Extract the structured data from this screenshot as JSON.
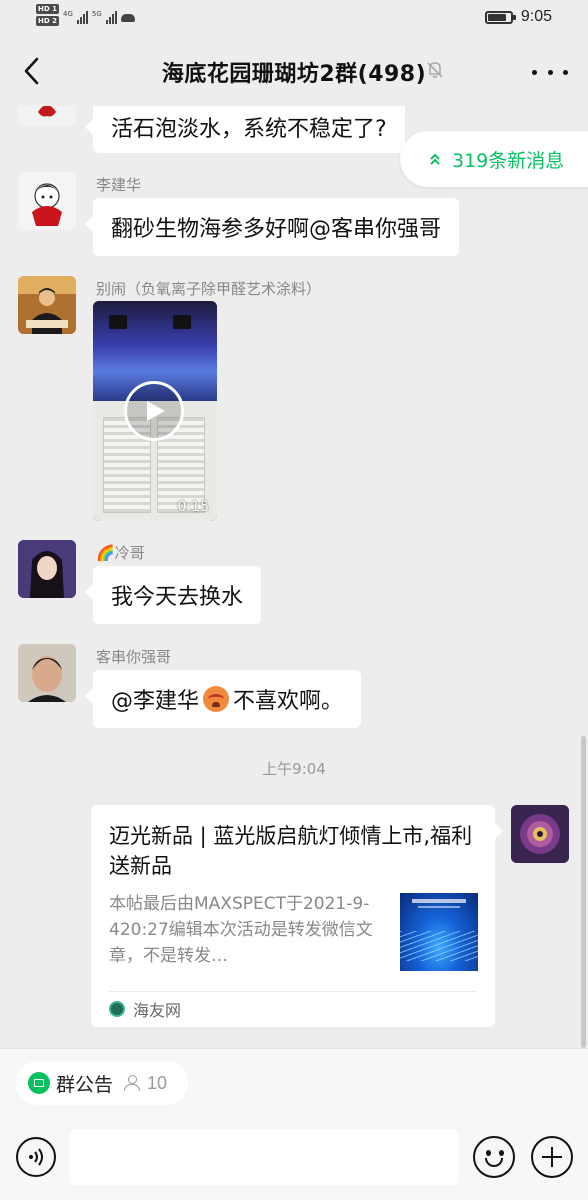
{
  "status_bar": {
    "hd1": "HD 1",
    "hd2": "HD 2",
    "net1": "4G",
    "net2": "5G",
    "time": "9:05",
    "battery_level": 0.8
  },
  "header": {
    "title": "海底花园珊瑚坊2群(498)",
    "back_icon": "chevron-left-icon",
    "mute_icon": "bell-off-icon",
    "more_icon": "more-dots-icon"
  },
  "new_messages": {
    "label": "319条新消息",
    "icon": "double-chevron-up-icon"
  },
  "messages": [
    {
      "type": "text",
      "sender": "",
      "text": "活石泡淡水，系统不稳定了?"
    },
    {
      "type": "text",
      "sender": "李建华",
      "text": "翻砂生物海参多好啊@客串你强哥"
    },
    {
      "type": "video",
      "sender": "别闹（负氧离子除甲醛艺术涂料）",
      "duration": "0:15"
    },
    {
      "type": "text",
      "sender": "🌈冷哥",
      "text": "我今天去换水"
    },
    {
      "type": "text",
      "sender": "客串你强哥",
      "text_before": "@李建华 ",
      "text_after": "不喜欢啊。"
    }
  ],
  "timestamp": "上午9:04",
  "link_card": {
    "title": "迈光新品 | 蓝光版启航灯倾情上市,福利送新品",
    "desc": "本帖最后由MAXSPECT于2021-9-420:27编辑本次活动是转发微信文章，不是转发…",
    "source": "海友网"
  },
  "bottom": {
    "notice_label": "群公告",
    "member_count": "10",
    "input_placeholder": ""
  },
  "colors": {
    "background": "#ededed",
    "accent": "#07c160",
    "bubble": "#ffffff"
  }
}
